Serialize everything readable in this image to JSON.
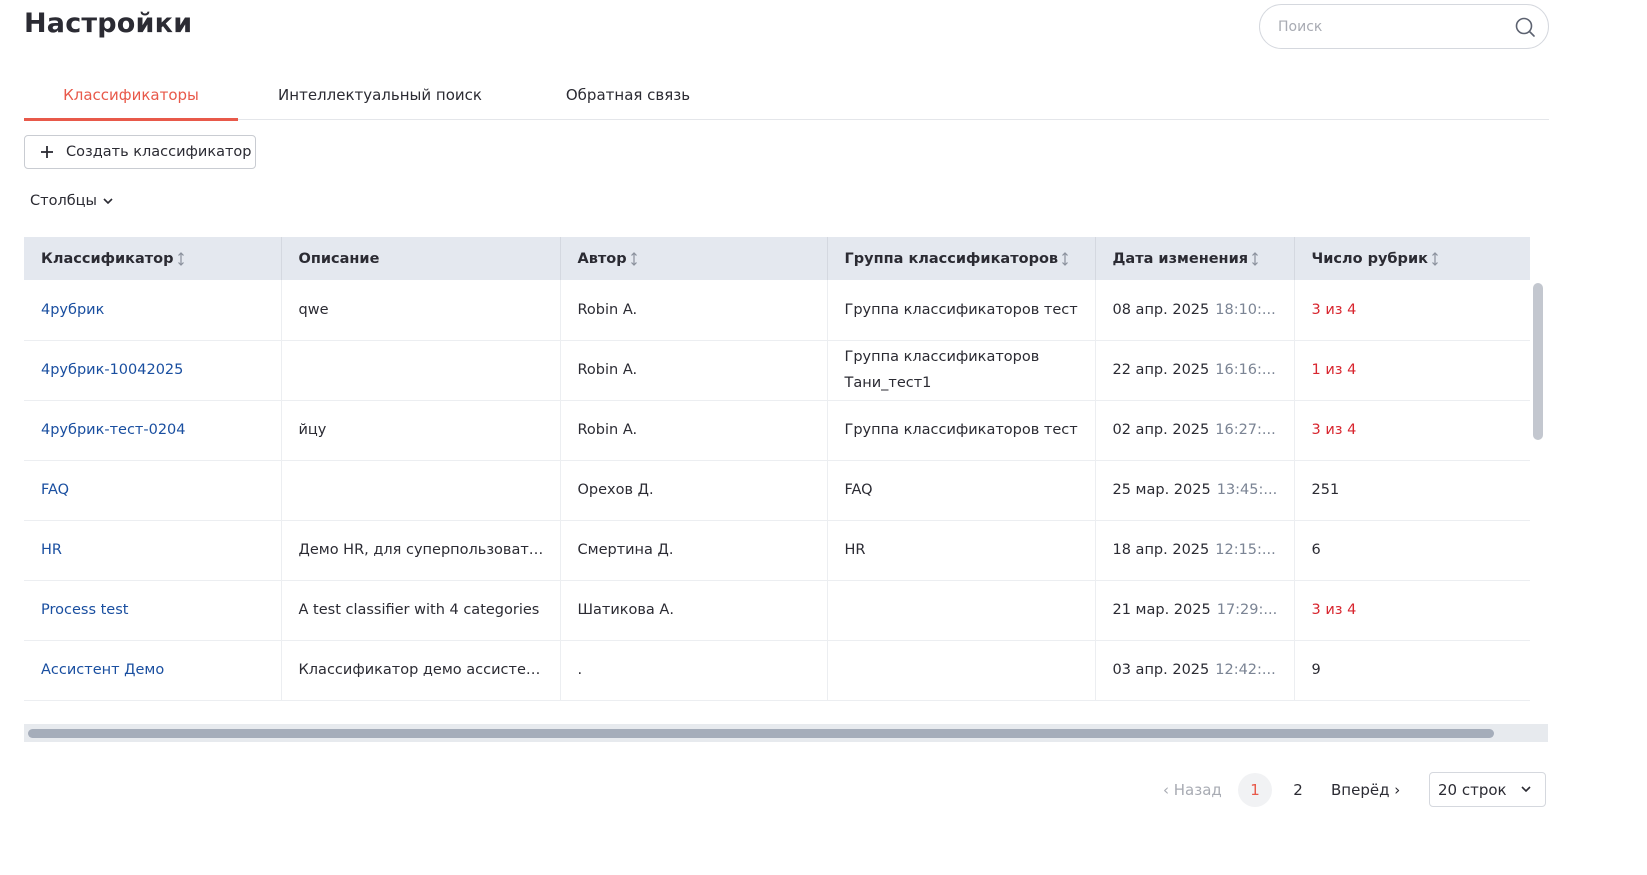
{
  "page": {
    "title": "Настройки",
    "search_placeholder": "Поиск"
  },
  "tabs": [
    {
      "label": "Классификаторы",
      "active": true
    },
    {
      "label": "Интеллектуальный поиск",
      "active": false
    },
    {
      "label": "Обратная связь",
      "active": false
    }
  ],
  "toolbar": {
    "create_label": "Создать классификатор",
    "columns_label": "Столбцы"
  },
  "table": {
    "columns": [
      {
        "label": "Классификатор",
        "sortable": true
      },
      {
        "label": "Описание",
        "sortable": false
      },
      {
        "label": "Автор",
        "sortable": true
      },
      {
        "label": "Группа классификаторов",
        "sortable": true
      },
      {
        "label": "Дата изменения",
        "sortable": true
      },
      {
        "label": "Число рубрик",
        "sortable": true
      }
    ],
    "rows": [
      {
        "name": "4рубрик",
        "description": "qwe",
        "author": "Robin A.",
        "group": "Группа классификаторов тест",
        "date": "08 апр. 2025",
        "time": "18:10:...",
        "rubrics": "3 из 4",
        "rubrics_alert": true
      },
      {
        "name": "4рубрик-10042025",
        "description": "",
        "author": "Robin A.",
        "group": "Группа классификаторов Тани_тест1",
        "date": "22 апр. 2025",
        "time": "16:16:...",
        "rubrics": "1 из 4",
        "rubrics_alert": true
      },
      {
        "name": "4рубрик-тест-0204",
        "description": "йцу",
        "author": "Robin A.",
        "group": "Группа классификаторов тест",
        "date": "02 апр. 2025",
        "time": "16:27:...",
        "rubrics": "3 из 4",
        "rubrics_alert": true
      },
      {
        "name": "FAQ",
        "description": "",
        "author": "Орехов Д.",
        "group": "FAQ",
        "date": "25 мар. 2025",
        "time": "13:45:...",
        "rubrics": "251",
        "rubrics_alert": false
      },
      {
        "name": "HR",
        "description": "Демо HR, для суперпользовател...",
        "author": "Смертина Д.",
        "group": "HR",
        "date": "18 апр. 2025",
        "time": "12:15:...",
        "rubrics": "6",
        "rubrics_alert": false
      },
      {
        "name": "Process test",
        "description": "A test classifier with 4 categories",
        "author": "Шатикова А.",
        "group": "",
        "date": "21 мар. 2025",
        "time": "17:29:...",
        "rubrics": "3 из 4",
        "rubrics_alert": true
      },
      {
        "name": "Ассистент Демо",
        "description": "Классификатор демо ассистент...",
        "author": ".",
        "group": "",
        "date": "03 апр. 2025",
        "time": "12:42:...",
        "rubrics": "9",
        "rubrics_alert": false
      }
    ]
  },
  "pagination": {
    "prev_label": "Назад",
    "next_label": "Вперёд",
    "pages": [
      "1",
      "2"
    ],
    "current_page": "1",
    "rows_per_page": "20 строк"
  },
  "colors": {
    "accent": "#e8594a",
    "link": "#1a4fa0",
    "alert": "#d8262f",
    "header_bg": "#e4e8ef"
  },
  "icons": {
    "search": "search-icon",
    "plus": "plus-icon",
    "chevron": "chevron-down-icon",
    "sort": "sort-icon"
  }
}
